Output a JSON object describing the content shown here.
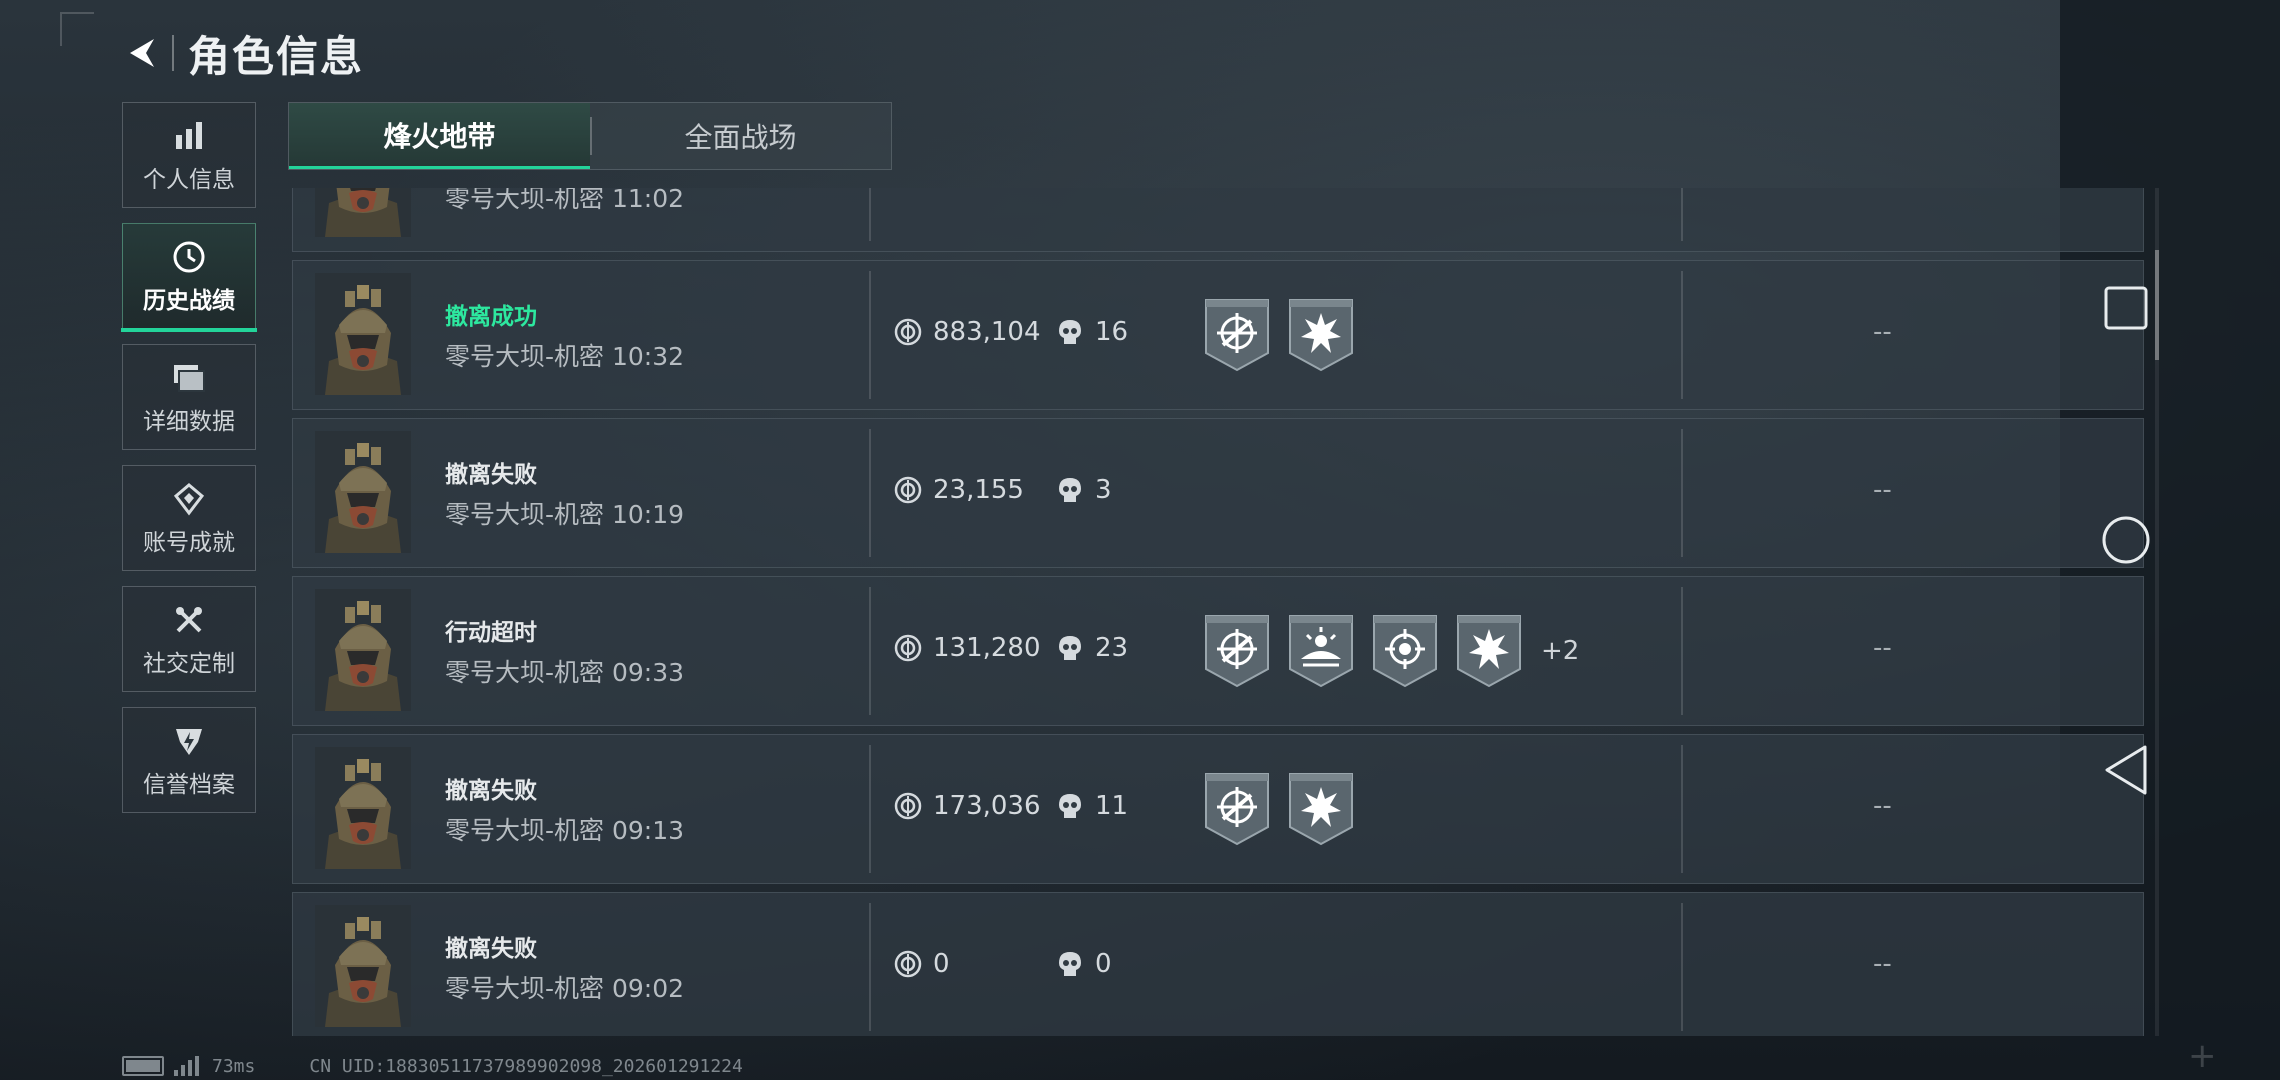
{
  "header": {
    "title": "角色信息",
    "back_icon": "back-arrow-icon"
  },
  "sidebar": {
    "items": [
      {
        "label": "个人信息",
        "icon": "bar-chart-icon",
        "active": false
      },
      {
        "label": "历史战绩",
        "icon": "history-clock-icon",
        "active": true
      },
      {
        "label": "详细数据",
        "icon": "folder-stack-icon",
        "active": false
      },
      {
        "label": "账号成就",
        "icon": "achievement-icon",
        "active": false
      },
      {
        "label": "社交定制",
        "icon": "tools-icon",
        "active": false
      },
      {
        "label": "信誉档案",
        "icon": "credit-shield-icon",
        "active": false
      }
    ]
  },
  "tabs": [
    {
      "label": "烽火地带",
      "active": true
    },
    {
      "label": "全面战场",
      "active": false
    }
  ],
  "records": [
    {
      "status": "",
      "map": "零号大坝-机密",
      "time": "11:02",
      "money": "",
      "kills": "",
      "badges": [],
      "extra": "",
      "result": "--"
    },
    {
      "status": "撤离成功",
      "map": "零号大坝-机密",
      "time": "10:32",
      "money": "883,104",
      "kills": "16",
      "badges": [
        "crosshair-badge-icon",
        "burst-badge-icon"
      ],
      "extra": "",
      "result": "--"
    },
    {
      "status": "撤离失败",
      "map": "零号大坝-机密",
      "time": "10:19",
      "money": "23,155",
      "kills": "3",
      "badges": [],
      "extra": "",
      "result": "--"
    },
    {
      "status": "行动超时",
      "map": "零号大坝-机密",
      "time": "09:33",
      "money": "131,280",
      "kills": "23",
      "badges": [
        "crosshair-badge-icon",
        "radar-badge-icon",
        "target-badge-icon",
        "burst-badge-icon"
      ],
      "extra": "+2",
      "result": "--"
    },
    {
      "status": "撤离失败",
      "map": "零号大坝-机密",
      "time": "09:13",
      "money": "173,036",
      "kills": "11",
      "badges": [
        "crosshair-badge-icon",
        "burst-badge-icon"
      ],
      "extra": "",
      "result": "--"
    },
    {
      "status": "撤离失败",
      "map": "零号大坝-机密",
      "time": "09:02",
      "money": "0",
      "kills": "0",
      "badges": [],
      "extra": "",
      "result": "--"
    }
  ],
  "footer": {
    "ping": "73ms",
    "uid": "CN UID:1883051173798990209​8_202601291224"
  },
  "colors": {
    "accent": "#23d49a",
    "success": "#2de89f"
  }
}
